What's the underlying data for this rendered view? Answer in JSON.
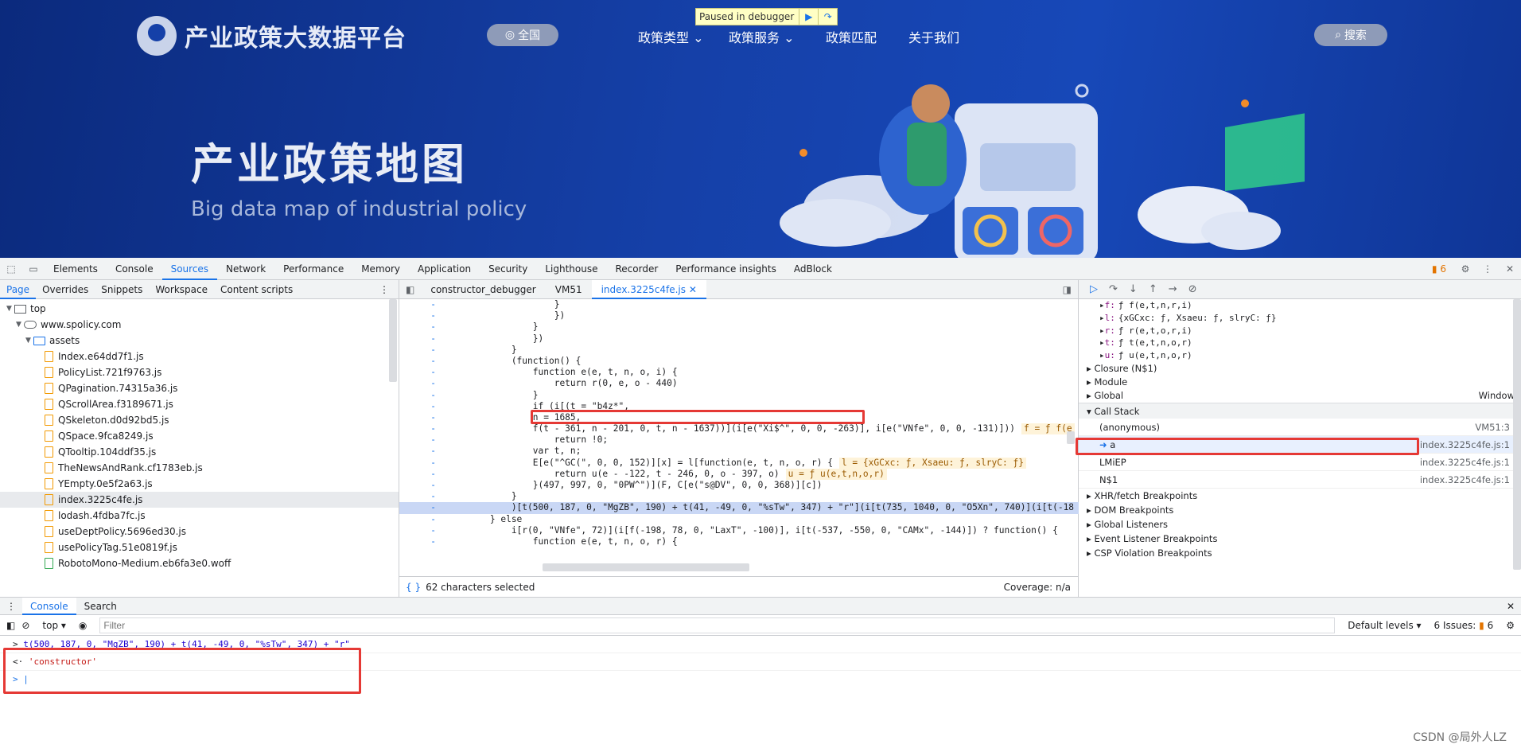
{
  "site": {
    "logo_text": "产业政策大数据平台",
    "region_label": "全国",
    "nav": [
      "政策类型",
      "政策服务",
      "政策匹配",
      "关于我们"
    ],
    "search_label": "搜索",
    "hero_title": "产业政策地图",
    "hero_subtitle": "Big data map of industrial policy",
    "paused_label": "Paused in debugger"
  },
  "devtools": {
    "main_tabs": [
      "Elements",
      "Console",
      "Sources",
      "Network",
      "Performance",
      "Memory",
      "Application",
      "Security",
      "Lighthouse",
      "Recorder",
      "Performance insights",
      "AdBlock"
    ],
    "active_tab": "Sources",
    "issues_count": "6",
    "nav_tabs": [
      "Page",
      "Overrides",
      "Snippets",
      "Workspace",
      "Content scripts"
    ],
    "tree": {
      "top": "top",
      "domain": "www.spolicy.com",
      "folder": "assets",
      "files": [
        "Index.e64dd7f1.js",
        "PolicyList.721f9763.js",
        "QPagination.74315a36.js",
        "QScrollArea.f3189671.js",
        "QSkeleton.d0d92bd5.js",
        "QSpace.9fca8249.js",
        "QTooltip.104ddf35.js",
        "TheNewsAndRank.cf1783eb.js",
        "YEmpty.0e5f2a63.js",
        "index.3225c4fe.js",
        "lodash.4fdba7fc.js",
        "useDeptPolicy.5696ed30.js",
        "usePolicyTag.51e0819f.js",
        "RobotoMono-Medium.eb6fa3e0.woff"
      ],
      "selected_file": "index.3225c4fe.js"
    },
    "file_tabs": [
      "constructor_debugger",
      "VM51",
      "index.3225c4fe.js"
    ],
    "code_lines": [
      "                    }",
      "                    })",
      "                }",
      "                })",
      "            }",
      "            (function() {",
      "                function e(e, t, n, o, i) {",
      "                    return r(0, e, o - 440)",
      "                }",
      "                if (i[(t = \"b4z*\",",
      "                n = 1685,",
      "                f(t - 361, n - 201, 0, t, n - 1637))](i[e(\"Xi$^\", 0, 0, -263)], i[e(\"VNfe\", 0, 0, -131)]))",
      "                    return !0;",
      "                var t, n;",
      "                E[e(\"^GC(\", 0, 0, 152)][x] = l[function(e, t, n, o, r) {",
      "                    return u(e - -122, t - 246, 0, o - 397, o)",
      "                }(497, 997, 0, \"0PW^\")](F, C[e(\"s@DV\", 0, 0, 368)][c])",
      "            }",
      "            )[t(500, 187, 0, \"MgZB\", 190) + t(41, -49, 0, \"%sTw\", 347) + \"r\"](i[t(735, 1040, 0, \"O5Xn\", 740)](i[t(-18",
      "        } else",
      "            i[r(0, \"VNfe\", 72)](i[f(-198, 78, 0, \"LaxT\", -100)], i[t(-537, -550, 0, \"CAMx\", -144)]) ? function() {",
      "                function e(e, t, n, o, r) {"
    ],
    "inline_values": {
      "line11": "f = ƒ f(e",
      "line14": "l = {xGCxc: ƒ, Xsaeu: ƒ, slryC: ƒ}",
      "line15": "u = ƒ u(e,t,n,o,r)"
    },
    "status_selected": "62 characters selected",
    "coverage": "Coverage: n/a",
    "scope": [
      {
        "k": "f:",
        "v": "ƒ f(e,t,n,r,i)"
      },
      {
        "k": "l:",
        "v": "{xGCxc: ƒ, Xsaeu: ƒ, slryC: ƒ}"
      },
      {
        "k": "r:",
        "v": "ƒ r(e,t,o,r,i)"
      },
      {
        "k": "t:",
        "v": "ƒ t(e,t,n,o,r)"
      },
      {
        "k": "u:",
        "v": "ƒ u(e,t,n,o,r)"
      }
    ],
    "scope_sections": [
      "Closure (N$1)",
      "Module",
      "Global"
    ],
    "global_value": "Window",
    "call_stack_label": "Call Stack",
    "call_stack": [
      {
        "name": "(anonymous)",
        "loc": "VM51:3"
      },
      {
        "name": "a",
        "loc": "index.3225c4fe.js:1"
      },
      {
        "name": "LMiEP",
        "loc": "index.3225c4fe.js:1"
      },
      {
        "name": "N$1",
        "loc": "index.3225c4fe.js:1"
      }
    ],
    "breakpoints": [
      "XHR/fetch Breakpoints",
      "DOM Breakpoints",
      "Global Listeners",
      "Event Listener Breakpoints",
      "CSP Violation Breakpoints"
    ],
    "drawer_tabs": [
      "Console",
      "Search"
    ],
    "context": "top",
    "filter_placeholder": "Filter",
    "levels": "Default levels",
    "issues": "6 Issues:",
    "console_input": "t(500, 187, 0, \"MgZB\", 190) + t(41, -49, 0, \"%sTw\", 347) + \"r\"",
    "console_output": "'constructor'"
  },
  "watermark": "CSDN @局外人LZ",
  "colors": {
    "accent": "#1a73e8",
    "highlight_box": "#e53935",
    "site_bg": "#1540a8"
  }
}
